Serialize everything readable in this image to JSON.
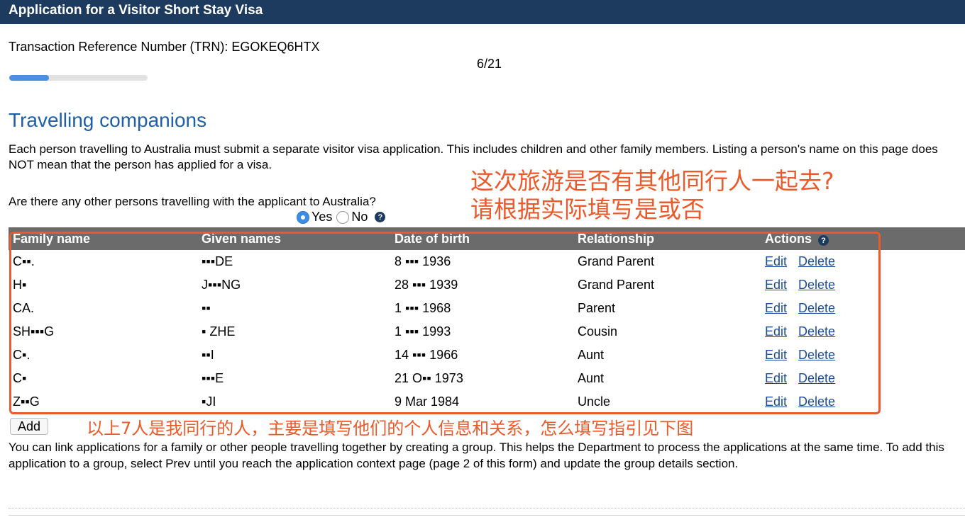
{
  "window": {
    "title": "Application for a Visitor Short Stay Visa"
  },
  "header": {
    "trn_label": "Transaction Reference Number (TRN): EGOKEQ6HTX",
    "step": "6/21",
    "progress": 0.2857
  },
  "section": {
    "title": "Travelling companions",
    "intro": "Each person travelling to Australia must submit a separate visitor visa application. This includes children and other family members. Listing a person's name on this page does NOT mean that the person has applied for a visa.",
    "question": "Are there any other persons travelling with the applicant to Australia?",
    "options": {
      "yes": "Yes",
      "no": "No"
    },
    "selected": "yes"
  },
  "table": {
    "headers": {
      "family": "Family name",
      "given": "Given names",
      "dob": "Date of birth",
      "relationship": "Relationship",
      "actions": "Actions"
    },
    "edit_label": "Edit",
    "delete_label": "Delete",
    "rows": [
      {
        "family": "C▪▪.",
        "given": "▪▪▪DE",
        "dob": "8 ▪▪▪ 1936",
        "relationship": "Grand Parent"
      },
      {
        "family": "H▪",
        "given": "J▪▪▪NG",
        "dob": "28 ▪▪▪ 1939",
        "relationship": "Grand Parent"
      },
      {
        "family": "CA.",
        "given": "▪▪",
        "dob": "1 ▪▪▪ 1968",
        "relationship": "Parent"
      },
      {
        "family": "SH▪▪▪G",
        "given": "▪ ZHE",
        "dob": "1 ▪▪▪ 1993",
        "relationship": "Cousin"
      },
      {
        "family": "C▪.",
        "given": "▪▪I",
        "dob": "14 ▪▪▪ 1966",
        "relationship": "Aunt"
      },
      {
        "family": "C▪",
        "given": "▪▪▪E",
        "dob": "21 O▪▪ 1973",
        "relationship": "Aunt"
      },
      {
        "family": "Z▪▪G",
        "given": "▪JI",
        "dob": "9 Mar 1984",
        "relationship": "Uncle"
      }
    ]
  },
  "add_label": "Add",
  "group_note": "You can link applications for a family or other people travelling together by creating a group. This helps the Department to process the applications at the same time. To add this application to a group, select Prev until you reach the application context page (page 2 of this form) and update the group details section.",
  "annotations": {
    "line1": "这次旅游是否有其他同行人一起去?",
    "line2": "请根据实际填写是或否",
    "line3": "以上7人是我同行的人，主要是填写他们的个人信息和关系，怎么填写指引见下图"
  },
  "colors": {
    "title_bar": "#1c3b5e",
    "heading": "#1f5fa6",
    "annotation": "#ea5a2a",
    "link": "#1a4c9c",
    "progress": "#4a90e2"
  },
  "icons": {
    "help": "question-circle-icon"
  }
}
